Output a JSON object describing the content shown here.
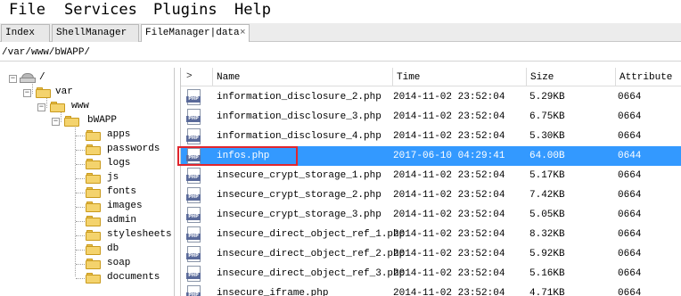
{
  "menu": {
    "items": [
      "File",
      "Services",
      "Plugins",
      "Help"
    ]
  },
  "tabs": [
    {
      "label": "Index",
      "active": false
    },
    {
      "label": "ShellManager",
      "active": false
    },
    {
      "label": "FileManager|data",
      "active": true
    }
  ],
  "tab_close_glyph": "×",
  "path": {
    "value": "/var/www/bWAPP/"
  },
  "tree": {
    "root": "/",
    "var": "var",
    "www": "www",
    "bwapp": "bWAPP",
    "folders": [
      "apps",
      "passwords",
      "logs",
      "js",
      "fonts",
      "images",
      "admin",
      "stylesheets",
      "db",
      "soap",
      "documents"
    ]
  },
  "filelist": {
    "headers": {
      "sort": ">",
      "name": "Name",
      "time": "Time",
      "size": "Size",
      "attribute": "Attribute"
    },
    "rows": [
      {
        "name": "information_disclosure_2.php",
        "time": "2014-11-02 23:52:04",
        "size": "5.29KB",
        "attr": "0664",
        "selected": false
      },
      {
        "name": "information_disclosure_3.php",
        "time": "2014-11-02 23:52:04",
        "size": "6.75KB",
        "attr": "0664",
        "selected": false
      },
      {
        "name": "information_disclosure_4.php",
        "time": "2014-11-02 23:52:04",
        "size": "5.30KB",
        "attr": "0664",
        "selected": false
      },
      {
        "name": "infos.php",
        "time": "2017-06-10 04:29:41",
        "size": "64.00B",
        "attr": "0644",
        "selected": true
      },
      {
        "name": "insecure_crypt_storage_1.php",
        "time": "2014-11-02 23:52:04",
        "size": "5.17KB",
        "attr": "0664",
        "selected": false
      },
      {
        "name": "insecure_crypt_storage_2.php",
        "time": "2014-11-02 23:52:04",
        "size": "7.42KB",
        "attr": "0664",
        "selected": false
      },
      {
        "name": "insecure_crypt_storage_3.php",
        "time": "2014-11-02 23:52:04",
        "size": "5.05KB",
        "attr": "0664",
        "selected": false
      },
      {
        "name": "insecure_direct_object_ref_1.php",
        "time": "2014-11-02 23:52:04",
        "size": "8.32KB",
        "attr": "0664",
        "selected": false
      },
      {
        "name": "insecure_direct_object_ref_2.php",
        "time": "2014-11-02 23:52:04",
        "size": "5.92KB",
        "attr": "0664",
        "selected": false
      },
      {
        "name": "insecure_direct_object_ref_3.php",
        "time": "2014-11-02 23:52:04",
        "size": "5.16KB",
        "attr": "0664",
        "selected": false
      },
      {
        "name": "insecure_iframe.php",
        "time": "2014-11-02 23:52:04",
        "size": "4.71KB",
        "attr": "0664",
        "selected": false
      }
    ],
    "icon_label": "PHP"
  },
  "colors": {
    "selection": "#3399ff",
    "highlight_box": "#e0262e",
    "folder": "#f4d36d"
  },
  "icons": {
    "folder": "folder-icon",
    "drive": "drive-icon",
    "php_file": "php-file-icon"
  }
}
